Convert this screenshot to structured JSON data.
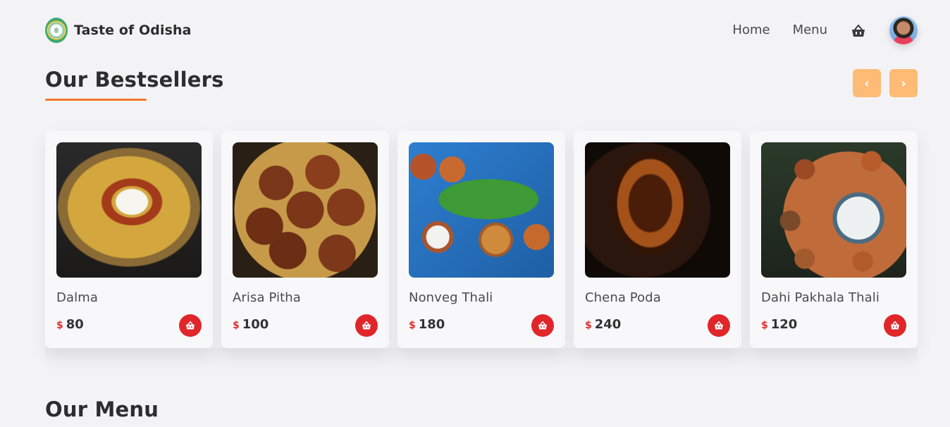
{
  "header": {
    "brand": "Taste of Odisha",
    "nav": {
      "home": "Home",
      "menu": "Menu"
    },
    "icons": {
      "logo": "logo-icon",
      "cart": "basket-icon",
      "avatar": "user-avatar"
    }
  },
  "bestsellers": {
    "title": "Our Bestsellers",
    "prev": "‹",
    "next": "›",
    "colors": {
      "underline": "#f0782a",
      "arrows": "#fdbb75",
      "add_button": "#e0262a",
      "currency": "#e0332f"
    },
    "items": [
      {
        "name": "Dalma",
        "currency": "$",
        "price": "80"
      },
      {
        "name": "Arisa Pitha",
        "currency": "$",
        "price": "100"
      },
      {
        "name": "Nonveg Thali",
        "currency": "$",
        "price": "180"
      },
      {
        "name": "Chena Poda",
        "currency": "$",
        "price": "240"
      },
      {
        "name": "Dahi Pakhala Thali",
        "currency": "$",
        "price": "120"
      }
    ]
  },
  "menu": {
    "title": "Our Menu"
  }
}
